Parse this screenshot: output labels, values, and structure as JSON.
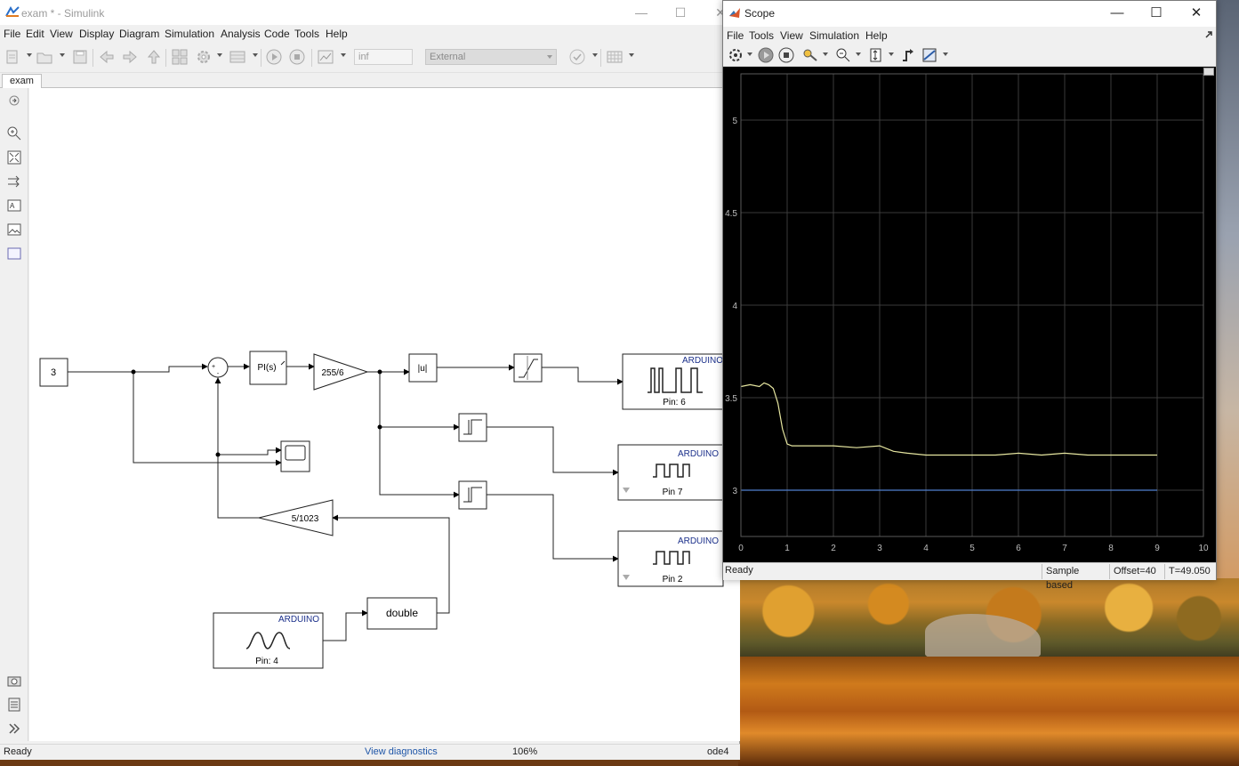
{
  "simulink": {
    "title": "exam * - Simulink",
    "menu": [
      "File",
      "Edit",
      "View",
      "Display",
      "Diagram",
      "Simulation",
      "Analysis",
      "Code",
      "Tools",
      "Help"
    ],
    "toolbar": {
      "stop_time": "inf",
      "sim_mode": "External"
    },
    "tab": "exam",
    "status": {
      "left": "Ready",
      "diagnostics": "View diagnostics",
      "zoom": "106%",
      "solver": "ode4"
    },
    "blocks": {
      "constant": "3",
      "sum_plus": "+",
      "sum_minus": "-",
      "pi": "PI(s)",
      "gain_main": "255/6",
      "abs": "|u|",
      "feedback_gain": "5/1023",
      "convert": "double",
      "arduino_label": "ARDUINO",
      "pwm6_pin": "Pin: 6",
      "dig7_pin": "Pin 7",
      "dig2_pin": "Pin 2",
      "analog_pin": "Pin: 4"
    }
  },
  "scope": {
    "title": "Scope",
    "menu": [
      "File",
      "Tools",
      "View",
      "Simulation",
      "Help"
    ],
    "status": {
      "left": "Ready",
      "mode": "Sample based",
      "offset": "Offset=40",
      "time": "T=49.050"
    },
    "colors": {
      "background": "#000000",
      "grid": "#3a3a3a",
      "signal": "#e6e6a0",
      "reference": "#4f7fd0"
    }
  },
  "chart_data": {
    "type": "line",
    "title": "",
    "xlabel": "",
    "ylabel": "",
    "xlim": [
      0,
      10
    ],
    "ylim": [
      2.75,
      5.25
    ],
    "xticks": [
      0,
      1,
      2,
      3,
      4,
      5,
      6,
      7,
      8,
      9,
      10
    ],
    "yticks": [
      3,
      3.5,
      4,
      4.5,
      5
    ],
    "grid": true,
    "series": [
      {
        "x": [
          0,
          0.2,
          0.4,
          0.5,
          0.6,
          0.7,
          0.8,
          0.9,
          1.0,
          1.1,
          1.5,
          2.0,
          2.5,
          3.0,
          3.3,
          3.6,
          4.0,
          4.5,
          5.0,
          5.5,
          6.0,
          6.5,
          7.0,
          7.5,
          8.0,
          8.5,
          9.0
        ],
        "y": [
          3.56,
          3.57,
          3.56,
          3.58,
          3.57,
          3.55,
          3.47,
          3.33,
          3.25,
          3.24,
          3.24,
          3.24,
          3.23,
          3.24,
          3.21,
          3.2,
          3.19,
          3.19,
          3.19,
          3.19,
          3.2,
          3.19,
          3.2,
          3.19,
          3.19,
          3.19,
          3.19
        ]
      },
      {
        "x": [
          0,
          9
        ],
        "y": [
          3,
          3
        ]
      }
    ]
  }
}
